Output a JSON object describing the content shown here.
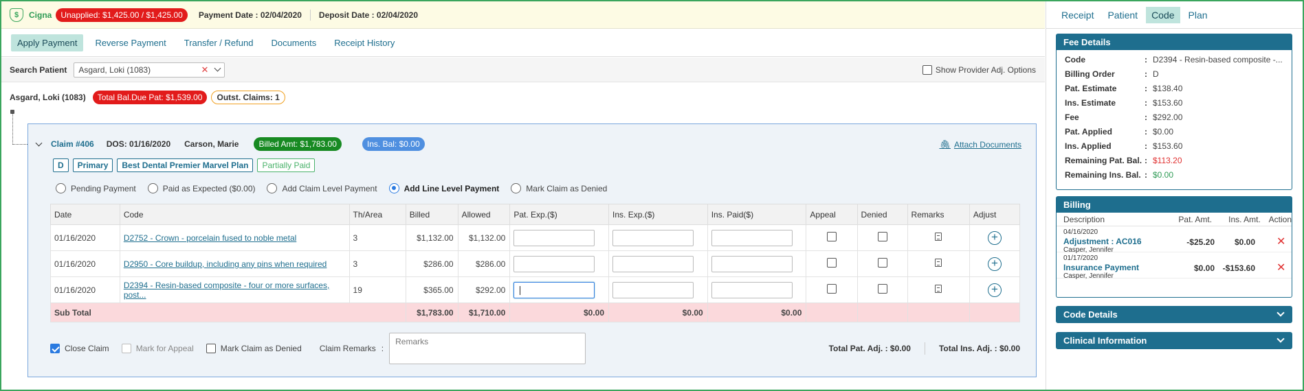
{
  "topbar": {
    "payer": "Cigna",
    "unapplied": "Unapplied: $1,425.00 / $1,425.00",
    "payment_date": "Payment Date : 02/04/2020",
    "deposit_date": "Deposit Date : 02/04/2020"
  },
  "nav": {
    "items": [
      "Apply Payment",
      "Reverse Payment",
      "Transfer / Refund",
      "Documents",
      "Receipt History"
    ]
  },
  "search": {
    "label": "Search Patient",
    "value": "Asgard, Loki (1083)",
    "show_provider_label": "Show Provider Adj. Options"
  },
  "patient": {
    "name": "Asgard, Loki (1083)",
    "total_bal": "Total Bal.Due Pat: $1,539.00",
    "outst_claims": "Outst. Claims: 1"
  },
  "claim": {
    "number": "Claim #406",
    "dos": "DOS: 01/16/2020",
    "provider": "Carson, Marie",
    "billed_amt": "Billed Amt: $1,783.00",
    "ins_bal": "Ins. Bal: $0.00",
    "attach": "Attach Documents",
    "tags": [
      "D",
      "Primary",
      "Best Dental Premier Marvel Plan"
    ],
    "status": "Partially Paid",
    "radios": [
      "Pending Payment",
      "Paid as Expected ($0.00)",
      "Add Claim Level Payment",
      "Add Line Level Payment",
      "Mark Claim as Denied"
    ],
    "selected_radio": "Add Line Level Payment",
    "columns": [
      "Date",
      "Code",
      "Th/Area",
      "Billed",
      "Allowed",
      "Pat. Exp.($)",
      "Ins. Exp.($)",
      "Ins. Paid($)",
      "Appeal",
      "Denied",
      "Remarks",
      "Adjust"
    ],
    "rows": [
      {
        "date": "01/16/2020",
        "code": "D2752 - Crown - porcelain fused to noble metal",
        "area": "3",
        "billed": "$1,132.00",
        "allowed": "$1,132.00"
      },
      {
        "date": "01/16/2020",
        "code": "D2950 - Core buildup, including any pins when required",
        "area": "3",
        "billed": "$286.00",
        "allowed": "$286.00"
      },
      {
        "date": "01/16/2020",
        "code": "D2394 - Resin-based composite - four or more surfaces, post...",
        "area": "19",
        "billed": "$365.00",
        "allowed": "$292.00"
      }
    ],
    "subtotal": {
      "label": "Sub Total",
      "billed": "$1,783.00",
      "allowed": "$1,710.00",
      "pat_exp": "$0.00",
      "ins_exp": "$0.00",
      "ins_paid": "$0.00"
    },
    "footer": {
      "close_claim": "Close Claim",
      "mark_appeal": "Mark for Appeal",
      "mark_denied": "Mark Claim as Denied",
      "remarks_label": "Claim Remarks",
      "remarks_colon": ":",
      "remarks_placeholder": "Remarks",
      "total_pat_adj": "Total Pat. Adj.  :  $0.00",
      "total_ins_adj": "Total Ins. Adj.  :  $0.00"
    }
  },
  "right": {
    "tabs": [
      "Receipt",
      "Patient",
      "Code",
      "Plan"
    ],
    "active_tab": "Code",
    "fee_details": {
      "title": "Fee Details",
      "rows": [
        {
          "k": "Code",
          "v": "D2394 - Resin-based composite -..."
        },
        {
          "k": "Billing Order",
          "v": "D"
        },
        {
          "k": "Pat. Estimate",
          "v": "$138.40"
        },
        {
          "k": "Ins. Estimate",
          "v": "$153.60"
        },
        {
          "k": "Fee",
          "v": "$292.00"
        },
        {
          "k": "Pat. Applied",
          "v": "$0.00"
        },
        {
          "k": "Ins. Applied",
          "v": "$153.60"
        },
        {
          "k": "Remaining Pat. Bal.",
          "v": "$113.20"
        },
        {
          "k": "Remaining Ins. Bal.",
          "v": "$0.00"
        }
      ]
    },
    "billing": {
      "title": "Billing",
      "headers": [
        "Description",
        "Pat. Amt.",
        "Ins. Amt.",
        "Action"
      ],
      "rows": [
        {
          "date": "04/16/2020",
          "desc": "Adjustment : AC016",
          "user": "Casper, Jennifer",
          "pat": "-$25.20",
          "ins": "$0.00"
        },
        {
          "date": "01/17/2020",
          "desc": "Insurance Payment",
          "user": "Casper, Jennifer",
          "pat": "$0.00",
          "ins": "-$153.60"
        }
      ]
    },
    "code_details": "Code Details",
    "clinical_info": "Clinical Information"
  }
}
